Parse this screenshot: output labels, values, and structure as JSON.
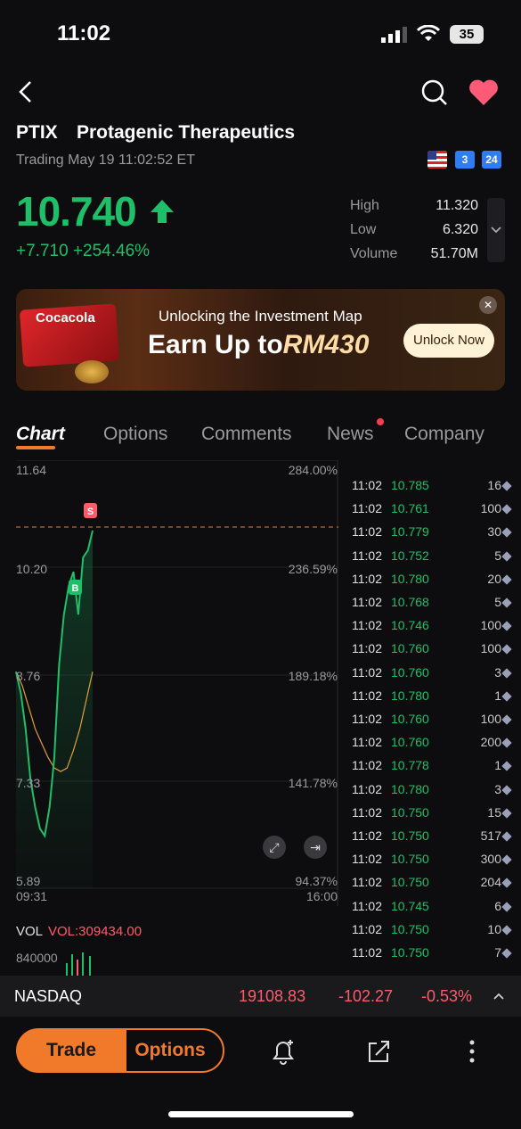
{
  "status_bar": {
    "time": "11:02",
    "battery": "35"
  },
  "header": {
    "ticker": "PTIX",
    "company": "Protagenic Therapeutics",
    "trading_status": "Trading May 19 11:02:52 ET",
    "badge_3": "3",
    "badge_24": "24"
  },
  "quote": {
    "price": "10.740",
    "change": "+7.710",
    "change_pct": "+254.46%",
    "stats": [
      {
        "label": "High",
        "value": "11.320"
      },
      {
        "label": "Low",
        "value": "6.320"
      },
      {
        "label": "Volume",
        "value": "51.70M"
      }
    ]
  },
  "banner": {
    "card_text": "Cocacola",
    "line1": "Unlocking the Investment Map",
    "line2": "Earn Up to",
    "amount": "RM430",
    "button": "Unlock Now"
  },
  "tabs": [
    "Chart",
    "Options",
    "Comments",
    "News",
    "Company"
  ],
  "chart": {
    "y_left": [
      "11.64",
      "10.20",
      "8.76",
      "7.33",
      "5.89"
    ],
    "y_right": [
      "284.00%",
      "236.59%",
      "189.18%",
      "141.78%",
      "94.37%"
    ],
    "x_start": "09:31",
    "x_end": "16:00",
    "marker_s": "S",
    "marker_b": "B"
  },
  "chart_data": {
    "type": "line",
    "title": "",
    "xlabel": "",
    "ylabel": "",
    "x_range": [
      "09:31",
      "16:00"
    ],
    "ylim": [
      5.89,
      11.64
    ],
    "series": [
      {
        "values": [
          8.8,
          8.5,
          8.0,
          7.3,
          6.9,
          6.6,
          6.5,
          6.9,
          7.6,
          8.9,
          9.6,
          10.0,
          10.2,
          9.6,
          10.4,
          10.5,
          10.78
        ]
      },
      {
        "values": [
          8.8,
          8.6,
          8.3,
          8.0,
          7.8,
          7.6,
          7.45,
          7.4,
          7.45,
          7.7,
          8.0,
          8.4,
          8.8
        ]
      }
    ]
  },
  "ticks": [
    {
      "time": "11:02",
      "price": "10.785",
      "vol": "16"
    },
    {
      "time": "11:02",
      "price": "10.761",
      "vol": "100"
    },
    {
      "time": "11:02",
      "price": "10.779",
      "vol": "30"
    },
    {
      "time": "11:02",
      "price": "10.752",
      "vol": "5"
    },
    {
      "time": "11:02",
      "price": "10.780",
      "vol": "20"
    },
    {
      "time": "11:02",
      "price": "10.768",
      "vol": "5"
    },
    {
      "time": "11:02",
      "price": "10.746",
      "vol": "100"
    },
    {
      "time": "11:02",
      "price": "10.760",
      "vol": "100"
    },
    {
      "time": "11:02",
      "price": "10.760",
      "vol": "3"
    },
    {
      "time": "11:02",
      "price": "10.780",
      "vol": "1"
    },
    {
      "time": "11:02",
      "price": "10.760",
      "vol": "100"
    },
    {
      "time": "11:02",
      "price": "10.760",
      "vol": "200"
    },
    {
      "time": "11:02",
      "price": "10.778",
      "vol": "1"
    },
    {
      "time": "11:02",
      "price": "10.780",
      "vol": "3"
    },
    {
      "time": "11:02",
      "price": "10.750",
      "vol": "15"
    },
    {
      "time": "11:02",
      "price": "10.750",
      "vol": "517"
    },
    {
      "time": "11:02",
      "price": "10.750",
      "vol": "300"
    },
    {
      "time": "11:02",
      "price": "10.750",
      "vol": "204"
    },
    {
      "time": "11:02",
      "price": "10.745",
      "vol": "6"
    },
    {
      "time": "11:02",
      "price": "10.750",
      "vol": "10"
    },
    {
      "time": "11:02",
      "price": "10.750",
      "vol": "7"
    }
  ],
  "volume": {
    "label": "VOL",
    "value": "VOL:309434.00",
    "axis": "840000"
  },
  "index_bar": {
    "name": "NASDAQ",
    "value": "19108.83",
    "change": "-102.27",
    "change_pct": "-0.53%"
  },
  "bottom": {
    "trade": "Trade",
    "options": "Options"
  },
  "colors": {
    "up": "#1fbf6a",
    "down": "#ff5b6a",
    "accent": "#f07a2a"
  }
}
